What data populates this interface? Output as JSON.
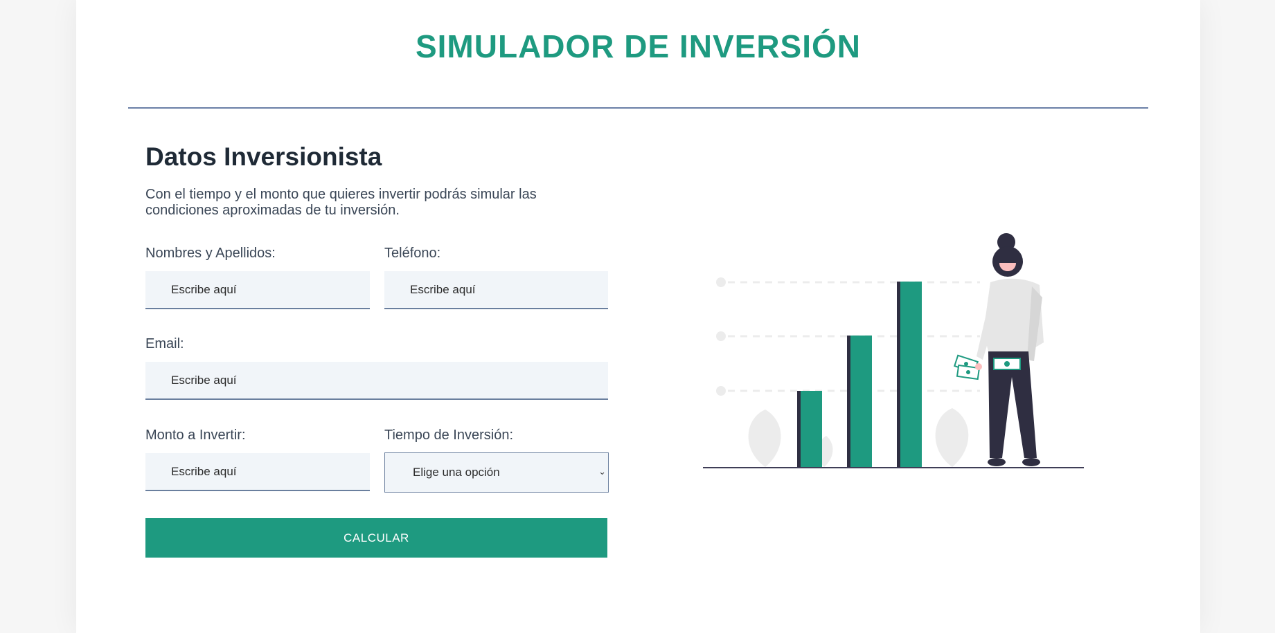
{
  "header": {
    "title": "SIMULADOR DE INVERSIÓN"
  },
  "form": {
    "section_title": "Datos Inversionista",
    "description": "Con el tiempo y el monto que quieres invertir podrás simular las condiciones aproximadas de tu inversión.",
    "fields": {
      "name": {
        "label": "Nombres y Apellidos:",
        "placeholder": "Escribe aquí"
      },
      "phone": {
        "label": "Teléfono:",
        "placeholder": "Escribe aquí"
      },
      "email": {
        "label": "Email:",
        "placeholder": "Escribe aquí"
      },
      "amount": {
        "label": "Monto a Invertir:",
        "placeholder": "Escribe aquí"
      },
      "time": {
        "label": "Tiempo de Inversión:",
        "selected": "Elige una opción"
      }
    },
    "submit_label": "CALCULAR"
  },
  "illustration": {
    "icon": "woman-with-growth-bar-chart-illustration",
    "accent_color": "#1e9a80"
  }
}
